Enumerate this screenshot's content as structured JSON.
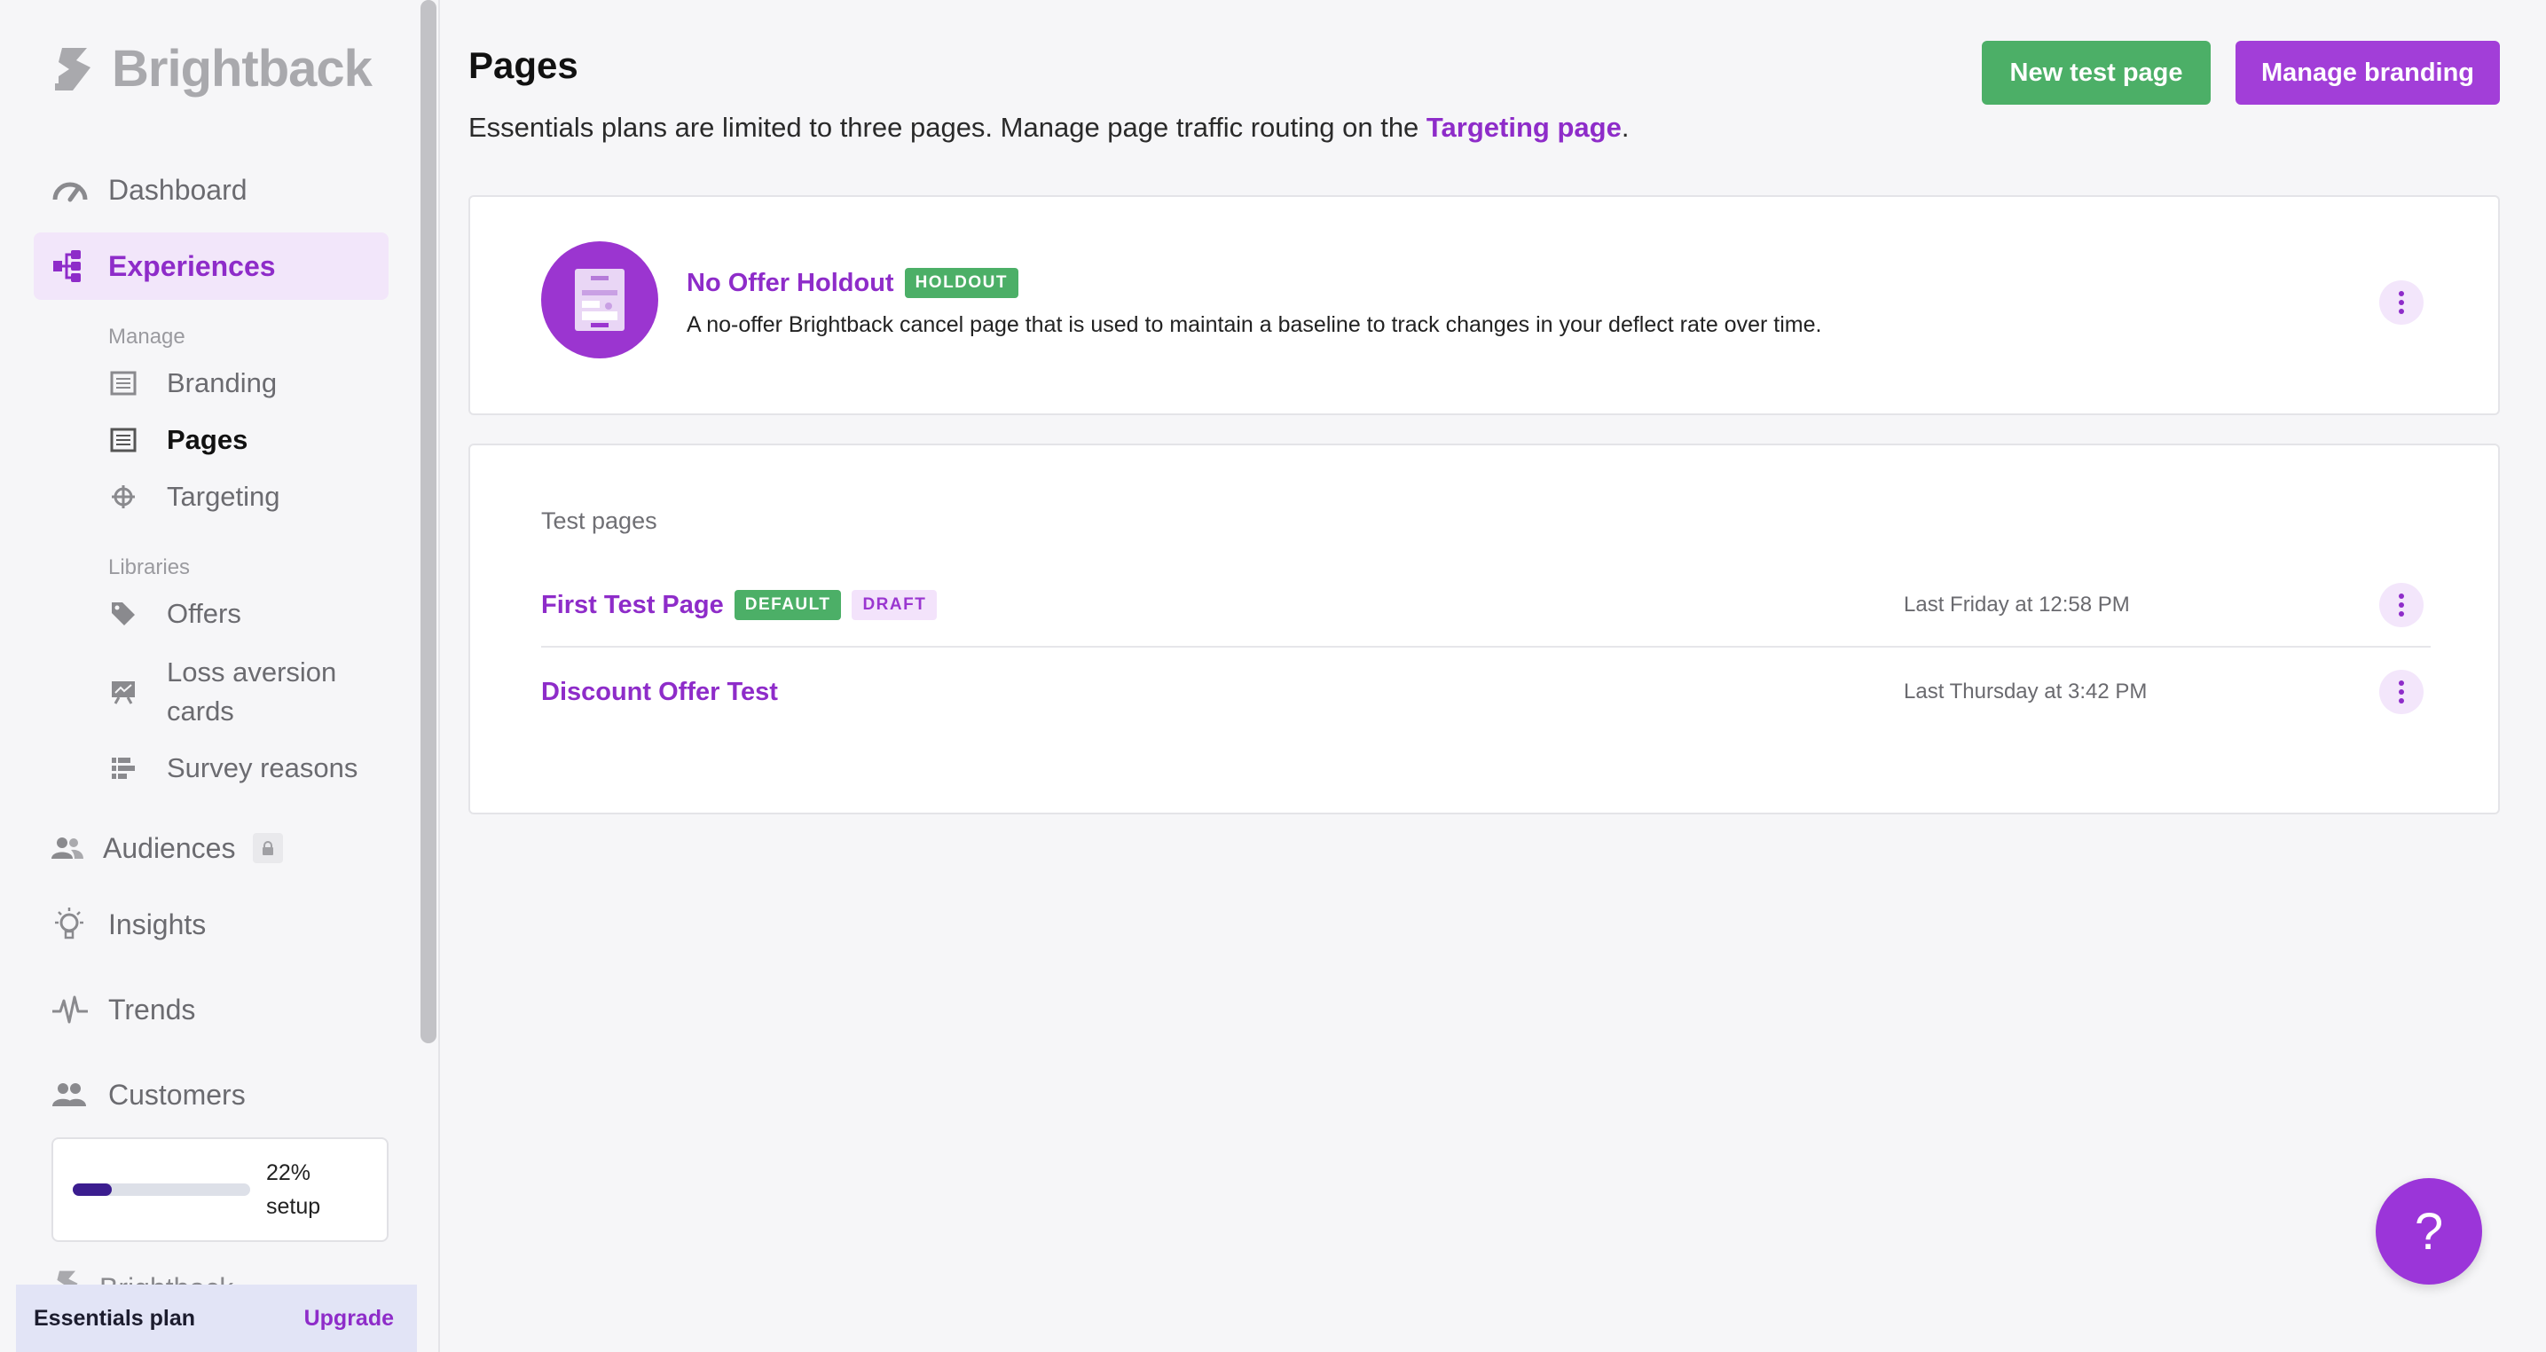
{
  "brand": {
    "name": "Brightback"
  },
  "nav": {
    "dashboard": "Dashboard",
    "experiences": "Experiences",
    "manage_heading": "Manage",
    "branding": "Branding",
    "pages": "Pages",
    "targeting": "Targeting",
    "libraries_heading": "Libraries",
    "offers": "Offers",
    "loss_aversion_line1": "Loss aversion",
    "loss_aversion_line2": "cards",
    "survey_reasons": "Survey reasons",
    "audiences": "Audiences",
    "insights": "Insights",
    "trends": "Trends",
    "customers": "Customers",
    "partial_item": "Brightback"
  },
  "setup": {
    "percent_label": "22%",
    "setup_label": "setup",
    "progress": 0.22
  },
  "plan": {
    "name": "Essentials plan",
    "upgrade": "Upgrade"
  },
  "header": {
    "title": "Pages",
    "description_prefix": "Essentials plans are limited to three pages. Manage page traffic routing on the ",
    "description_link": "Targeting page",
    "description_suffix": ".",
    "new_test_button": "New test page",
    "manage_branding_button": "Manage branding"
  },
  "holdout": {
    "name": "No Offer Holdout",
    "badge": "HOLDOUT",
    "description": "A no-offer Brightback cancel page that is used to maintain a baseline to track changes in your deflect rate over time."
  },
  "tests": {
    "section_label": "Test pages",
    "rows": [
      {
        "name": "First Test Page",
        "badges": [
          "DEFAULT",
          "DRAFT"
        ],
        "updated": "Last Friday at 12:58 PM"
      },
      {
        "name": "Discount Offer Test",
        "badges": [],
        "updated": "Last Thursday at 3:42 PM"
      }
    ]
  },
  "help": {
    "label": "?"
  },
  "colors": {
    "accent": "#8e2cc9",
    "green": "#4caf67",
    "purple_button": "#a23ed8"
  }
}
